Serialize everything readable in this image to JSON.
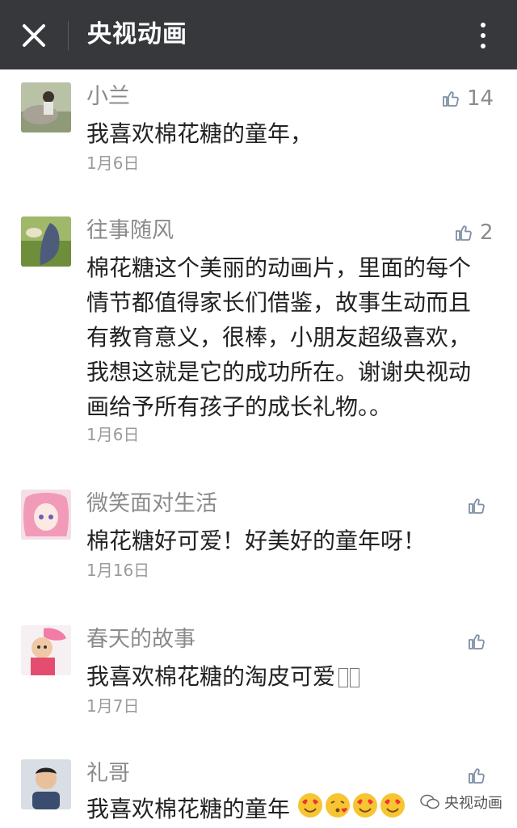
{
  "header": {
    "title": "央视动画"
  },
  "comments": [
    {
      "nickname": "小兰",
      "text": "我喜欢棉花糖的童年，",
      "date": "1月6日",
      "likes": "14"
    },
    {
      "nickname": "往事随风",
      "text_lines": [
        "棉花糖这个美丽的动画片，里面的每个",
        "情节都值得家长们借鉴，故事生动而且",
        "有教育意义，很棒，小朋友超级喜欢，",
        "我想这就是它的成功所在。谢谢央视动",
        "画给予所有孩子的成长礼物。。"
      ],
      "date": "1月6日",
      "likes": "2"
    },
    {
      "nickname": "微笑面对生活",
      "text": "棉花糖好可爱！好美好的童年呀！",
      "date": "1月16日",
      "likes": ""
    },
    {
      "nickname": "春天的故事",
      "text": "我喜欢棉花糖的淘皮可爱",
      "date": "1月7日",
      "likes": ""
    },
    {
      "nickname": "礼哥",
      "text": "我喜欢棉花糖的童年",
      "date": "",
      "likes": ""
    }
  ],
  "watermark": {
    "label": "央视动画"
  },
  "icons": {
    "close": "close-icon",
    "more": "more-vertical-icon",
    "like": "thumbs-up-icon",
    "wechat": "wechat-icon"
  },
  "colors": {
    "header_bg": "#37383c",
    "text": "#222222",
    "meta": "#8b8b8b"
  }
}
